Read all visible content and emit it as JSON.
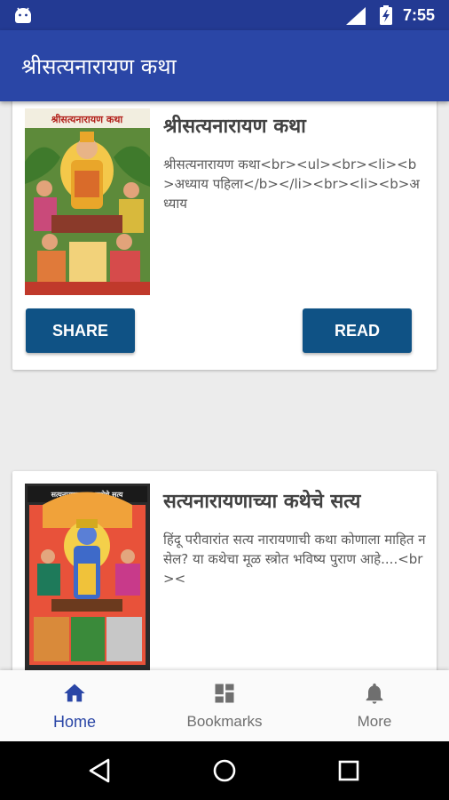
{
  "status_bar": {
    "time": "7:55"
  },
  "app_bar": {
    "title": "श्रीसत्यनारायण कथा"
  },
  "cards": [
    {
      "title": "श्रीसत्यनारायण कथा",
      "description": "श्रीसत्यनारायण कथा<br><ul><br><li><b>अध्याय पहिला</b></li><br><li><b>अध्याय",
      "image_caption": "श्रीसत्यनारायण कथा",
      "share_label": "SHARE",
      "read_label": "READ"
    },
    {
      "title": "सत्यनारायणाच्या कथेचे सत्य",
      "description": "हिंदू परीवारांत सत्य नारायणाची कथा कोणाला माहित नसेल?  या कथेचा मूळ स्त्रोत भविष्य पुराण आहे....<br><",
      "image_caption": "सत्यनारायणाच्या कथेचे सत्य"
    }
  ],
  "bottom_nav": {
    "items": [
      {
        "label": "Home",
        "icon": "home-icon",
        "active": true
      },
      {
        "label": "Bookmarks",
        "icon": "dashboard-icon",
        "active": false
      },
      {
        "label": "More",
        "icon": "bell-icon",
        "active": false
      }
    ]
  },
  "colors": {
    "status_bar": "#233a93",
    "app_bar": "#2a46a6",
    "button": "#0f5285",
    "active_nav": "#2a46a6"
  }
}
